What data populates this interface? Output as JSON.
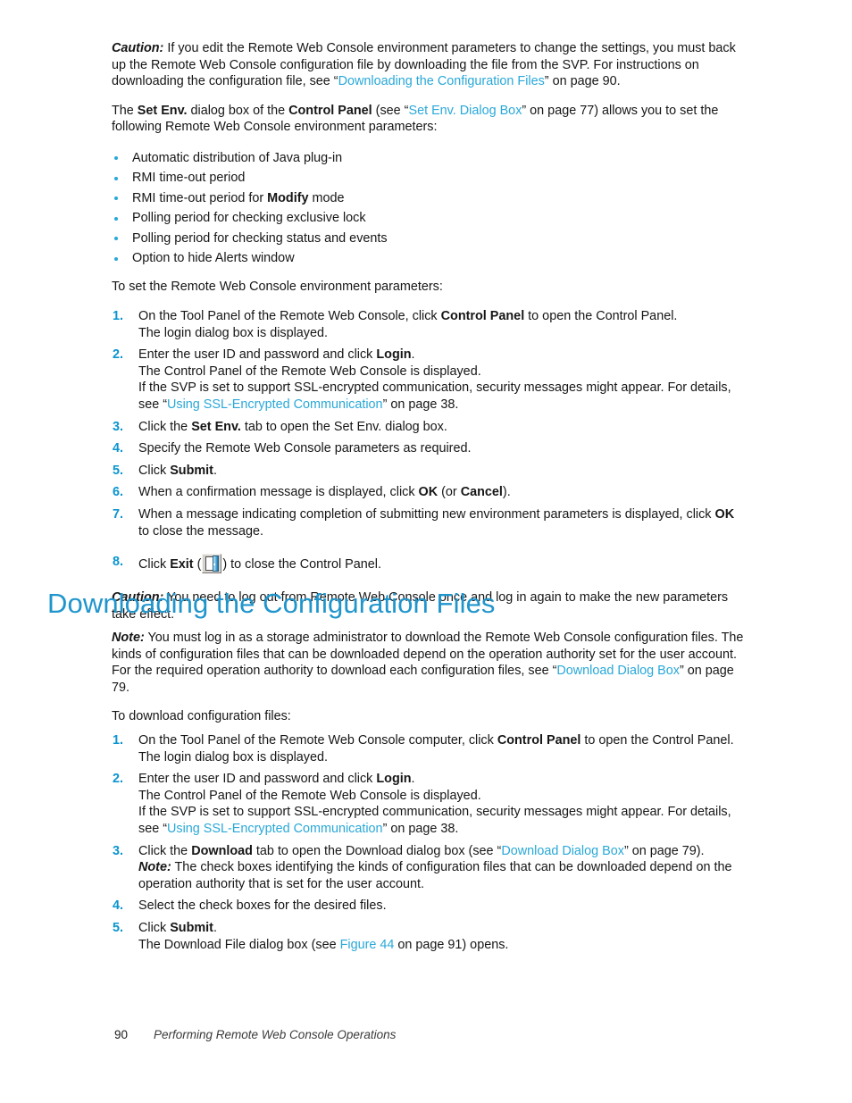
{
  "page": {
    "footer_page_number": "90",
    "footer_text": "Performing Remote Web Console Operations"
  },
  "colors": {
    "link": "#29a8d8",
    "heading": "#2095cc",
    "marker": "#0a94cf",
    "bullet": "#29a8d8",
    "body_text": "#161616"
  },
  "top_section": {
    "caution": {
      "label": "Caution:",
      "text_1": " If you edit the Remote Web Console environment parameters to change the settings, you must back up the Remote Web Console configuration file by downloading the file from the SVP. For instructions on downloading the configuration file, see “",
      "link": "Downloading the Configuration Files",
      "text_2": "” on page 90."
    },
    "intro": {
      "text_1": "The ",
      "bold_1": "Set Env.",
      "text_2": " dialog box of the ",
      "bold_2": "Control Panel",
      "text_3": " (see “",
      "link": "Set Env.  Dialog Box",
      "text_4": "” on page 77) allows you to set the following Remote Web Console environment parameters:"
    },
    "bullets": [
      {
        "text_1": "Automatic distribution of Java plug-in",
        "bold": "",
        "text_2": ""
      },
      {
        "text_1": "RMI time-out period",
        "bold": "",
        "text_2": ""
      },
      {
        "text_1": "RMI time-out period for ",
        "bold": "Modify",
        "text_2": " mode"
      },
      {
        "text_1": "Polling period for checking exclusive lock",
        "bold": "",
        "text_2": ""
      },
      {
        "text_1": "Polling period for checking status and events",
        "bold": "",
        "text_2": ""
      },
      {
        "text_1": "Option to hide Alerts window",
        "bold": "",
        "text_2": ""
      }
    ],
    "procedure_intro": "To set the Remote Web Console environment parameters:",
    "steps": {
      "s1": {
        "number": "1.",
        "l1_a": "On the Tool Panel of the Remote Web Console, click ",
        "l1_b": "Control Panel",
        "l1_c": " to open the Control Panel.",
        "l2": "The login dialog box is displayed."
      },
      "s2": {
        "number": "2.",
        "l1_a": "Enter the user ID and password and click ",
        "l1_b": "Login",
        "l1_c": ".",
        "l2": "The Control Panel of the Remote Web Console is displayed.",
        "l3_a": "If the SVP is set to support SSL-encrypted communication, security messages might appear.  For details, see “",
        "l3_link": "Using SSL-Encrypted Communication",
        "l3_b": "” on page 38."
      },
      "s3": {
        "number": "3.",
        "l1_a": "Click the ",
        "l1_b": "Set Env.",
        "l1_c": " tab to open the Set Env.  dialog box."
      },
      "s4": {
        "number": "4.",
        "l1_a": "Specify the Remote Web Console parameters as required."
      },
      "s5": {
        "number": "5.",
        "l1_a": "Click ",
        "l1_b": "Submit",
        "l1_c": "."
      },
      "s6": {
        "number": "6.",
        "l1_a": "When a confirmation message is displayed, click ",
        "l1_b": "OK",
        "l1_c": " (or ",
        "l1_d": "Cancel",
        "l1_e": ")."
      },
      "s7": {
        "number": "7.",
        "l1_a": "When a message indicating completion of submitting new environment parameters is displayed, click ",
        "l1_b": "OK",
        "l1_c": " to close the message."
      },
      "s8": {
        "number": "8.",
        "l1_a": "Click ",
        "l1_b": "Exit",
        "l1_c": " (",
        "icon": "exit-door-icon",
        "l1_d": ") to close the Control Panel."
      }
    },
    "caution2": {
      "label": "Caution:",
      "text": " You need to log out from Remote Web Console once and log in again to make the new parameters take effect."
    }
  },
  "section": {
    "heading": "Downloading the Configuration Files",
    "note": {
      "label": "Note:",
      "text_1": " You must log in as a storage administrator to download the Remote Web Console configuration files.  The kinds of configuration files that can be downloaded depend on the operation authority set for the user account.  For the required operation authority to download each configuration files, see “",
      "link": "Download Dialog Box",
      "text_2": "” on page 79."
    },
    "procedure_intro": "To download configuration files:",
    "steps": {
      "s1": {
        "number": "1.",
        "l1_a": "On the Tool Panel of the Remote Web Console computer, click ",
        "l1_b": "Control Panel",
        "l1_c": " to open the Control Panel.",
        "l2": "The login dialog box is displayed."
      },
      "s2": {
        "number": "2.",
        "l1_a": "Enter the user ID and password and click ",
        "l1_b": "Login",
        "l1_c": ".",
        "l2": "The Control Panel of the Remote Web Console is displayed.",
        "l3_a": "If the SVP is set to support SSL-encrypted communication, security messages might appear.  For details, see “",
        "l3_link": "Using SSL-Encrypted Communication",
        "l3_b": "” on page 38."
      },
      "s3": {
        "number": "3.",
        "l1_a": "Click the ",
        "l1_b": "Download",
        "l1_c": " tab to open the Download dialog box (see “",
        "l1_link": "Download Dialog Box",
        "l1_d": "” on page 79).",
        "note_label": "Note:",
        "note_text": " The check boxes identifying the kinds of configuration files that can be downloaded depend on the operation authority that is set for the user account."
      },
      "s4": {
        "number": "4.",
        "l1_a": "Select the check boxes for the desired files."
      },
      "s5": {
        "number": "5.",
        "l1_a": "Click ",
        "l1_b": "Submit",
        "l1_c": ".",
        "l2_a": "The Download File dialog box (see ",
        "l2_link": "Figure 44",
        "l2_b": " on page 91) opens."
      }
    }
  }
}
